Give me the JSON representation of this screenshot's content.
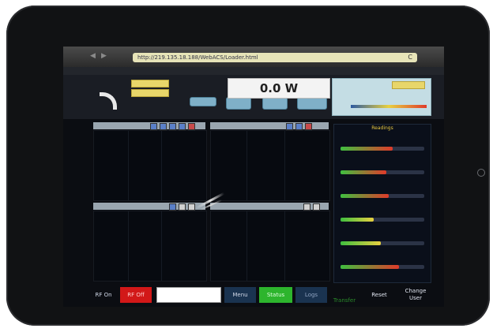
{
  "browser": {
    "url": "http://219.135.18.188/WebACS/Loader.html",
    "reload_glyph": "C",
    "nav_back": "◀",
    "nav_fwd": "▶"
  },
  "header": {
    "power_reading": "0.0 W",
    "left_buttons": [
      "",
      ""
    ],
    "mid_buttons": [
      "",
      "",
      "",
      ""
    ]
  },
  "graph_controls": {
    "left": [
      "◀",
      "▶",
      "■",
      "▲",
      "▼"
    ],
    "right": [
      "◀",
      "▶",
      "■"
    ],
    "lower_left": [
      "◀",
      "▶"
    ],
    "lower_right": [
      "▲",
      "▼"
    ]
  },
  "sidebar": {
    "title": "Readings",
    "bars": [
      {
        "label": "",
        "color": "#e03a2a",
        "fill": 0.62
      },
      {
        "label": "",
        "color": "#e03a2a",
        "fill": 0.55
      },
      {
        "label": "",
        "color": "#e03a2a",
        "fill": 0.58
      },
      {
        "label": "",
        "color": "#e8d040",
        "fill": 0.4
      },
      {
        "label": "",
        "color": "#e8d040",
        "fill": 0.48
      },
      {
        "label": "",
        "color": "#e03a2a",
        "fill": 0.7
      }
    ]
  },
  "toolbar": {
    "rf_on": "RF On",
    "rf_off": "RF Off",
    "input_value": "",
    "menu": "Menu",
    "status": "Status",
    "logs": "Logs",
    "green_label": "Transfer",
    "reset": "Reset",
    "change_user": "Change User"
  },
  "colors": {
    "accent_green": "#2db52d",
    "accent_red": "#d21818",
    "status_yellow": "#e8d040"
  }
}
